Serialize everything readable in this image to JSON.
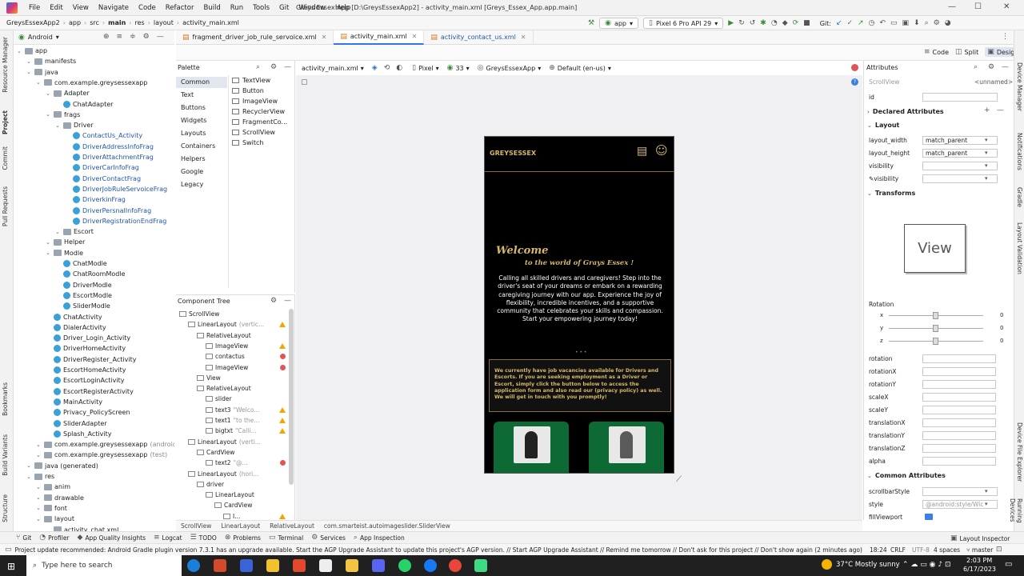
{
  "menubar": {
    "items": [
      "File",
      "Edit",
      "View",
      "Navigate",
      "Code",
      "Refactor",
      "Build",
      "Run",
      "Tools",
      "Git",
      "Window",
      "Help"
    ],
    "title": "Greys Essex App [D:\\GreysEssexApp2] - activity_main.xml [Greys_Essex_App.app.main]"
  },
  "navbar": {
    "crumbs": [
      "GreysEssexApp2",
      "app",
      "src",
      "main",
      "res",
      "layout",
      "activity_main.xml"
    ],
    "run_config": "app",
    "device": "Pixel 6 Pro API 29",
    "git_label": "Git:"
  },
  "project": {
    "view": "Android",
    "tree": [
      {
        "label": "app",
        "level": 0,
        "type": "folder"
      },
      {
        "label": "manifests",
        "level": 1,
        "type": "folder"
      },
      {
        "label": "java",
        "level": 1,
        "type": "folder"
      },
      {
        "label": "com.example.greysessexapp",
        "level": 2,
        "type": "folder"
      },
      {
        "label": "Adapter",
        "level": 3,
        "type": "folder"
      },
      {
        "label": "ChatAdapter",
        "level": 4,
        "type": "class"
      },
      {
        "label": "frags",
        "level": 3,
        "type": "folder"
      },
      {
        "label": "Driver",
        "level": 4,
        "type": "folder"
      },
      {
        "label": "ContactUs_Activity",
        "level": 5,
        "type": "class"
      },
      {
        "label": "DriverAddressInfoFrag",
        "level": 5,
        "type": "class"
      },
      {
        "label": "DriverAttachmentFrag",
        "level": 5,
        "type": "class"
      },
      {
        "label": "DriverCarInfoFrag",
        "level": 5,
        "type": "class"
      },
      {
        "label": "DriverContactFrag",
        "level": 5,
        "type": "class"
      },
      {
        "label": "DriverJobRuleServoiceFrag",
        "level": 5,
        "type": "class"
      },
      {
        "label": "DriverkinFrag",
        "level": 5,
        "type": "class"
      },
      {
        "label": "DriverPersnalInfoFrag",
        "level": 5,
        "type": "class"
      },
      {
        "label": "DriverRegistrationEndFrag",
        "level": 5,
        "type": "class"
      },
      {
        "label": "Escort",
        "level": 4,
        "type": "folder"
      },
      {
        "label": "Helper",
        "level": 3,
        "type": "folder"
      },
      {
        "label": "Modle",
        "level": 3,
        "type": "folder"
      },
      {
        "label": "ChatModle",
        "level": 4,
        "type": "class"
      },
      {
        "label": "ChatRoomModle",
        "level": 4,
        "type": "class"
      },
      {
        "label": "DriverModle",
        "level": 4,
        "type": "class"
      },
      {
        "label": "EscortModle",
        "level": 4,
        "type": "class"
      },
      {
        "label": "SliderModle",
        "level": 4,
        "type": "class"
      },
      {
        "label": "ChatActivity",
        "level": 3,
        "type": "class"
      },
      {
        "label": "DialerActivity",
        "level": 3,
        "type": "class"
      },
      {
        "label": "Driver_Login_Activity",
        "level": 3,
        "type": "class"
      },
      {
        "label": "DriverHomeActivity",
        "level": 3,
        "type": "class"
      },
      {
        "label": "DriverRegister_Activity",
        "level": 3,
        "type": "class"
      },
      {
        "label": "EscortHomeActivity",
        "level": 3,
        "type": "class"
      },
      {
        "label": "EscortLoginActivity",
        "level": 3,
        "type": "class"
      },
      {
        "label": "EscortRegisterActivity",
        "level": 3,
        "type": "class"
      },
      {
        "label": "MainActivity",
        "level": 3,
        "type": "class"
      },
      {
        "label": "Privacy_PolicyScreen",
        "level": 3,
        "type": "class"
      },
      {
        "label": "SliderAdapter",
        "level": 3,
        "type": "class"
      },
      {
        "label": "Splash_Activity",
        "level": 3,
        "type": "class"
      },
      {
        "label": "com.example.greysessexapp",
        "level": 2,
        "type": "folder",
        "suffix": "(androidTe"
      },
      {
        "label": "com.example.greysessexapp",
        "level": 2,
        "type": "folder",
        "suffix": "(test)"
      },
      {
        "label": "java (generated)",
        "level": 1,
        "type": "folder"
      },
      {
        "label": "res",
        "level": 1,
        "type": "folder"
      },
      {
        "label": "anim",
        "level": 2,
        "type": "folder"
      },
      {
        "label": "drawable",
        "level": 2,
        "type": "folder"
      },
      {
        "label": "font",
        "level": 2,
        "type": "folder"
      },
      {
        "label": "layout",
        "level": 2,
        "type": "folder"
      },
      {
        "label": "activity_chat.xml",
        "level": 3,
        "type": "file"
      }
    ]
  },
  "tabs": [
    {
      "label": "fragment_driver_job_rule_servoice.xml",
      "active": false
    },
    {
      "label": "activity_main.xml",
      "active": true
    },
    {
      "label": "activity_contact_us.xml",
      "active": false
    }
  ],
  "view_modes": [
    "Code",
    "Split",
    "Design"
  ],
  "palette": {
    "title": "Palette",
    "categories": [
      "Common",
      "Text",
      "Buttons",
      "Widgets",
      "Layouts",
      "Containers",
      "Helpers",
      "Google",
      "Legacy"
    ],
    "items": [
      "TextView",
      "Button",
      "ImageView",
      "RecyclerView",
      "FragmentCo...",
      "ScrollView",
      "Switch"
    ]
  },
  "design_toolbar": {
    "file": "activity_main.xml",
    "device": "Pixel",
    "api": "33",
    "theme": "GreysEssexApp",
    "locale": "Default (en-us)"
  },
  "component_tree": {
    "title": "Component Tree",
    "nodes": [
      {
        "label": "ScrollView",
        "level": 0,
        "mark": ""
      },
      {
        "label": "LinearLayout",
        "hint": "(vertic...",
        "level": 1,
        "mark": "warn"
      },
      {
        "label": "RelativeLayout",
        "level": 2,
        "mark": ""
      },
      {
        "label": "ImageView",
        "level": 3,
        "mark": "warn"
      },
      {
        "label": "contactus",
        "level": 3,
        "mark": "err"
      },
      {
        "label": "ImageView",
        "level": 3,
        "mark": "err"
      },
      {
        "label": "View",
        "level": 2,
        "mark": ""
      },
      {
        "label": "RelativeLayout",
        "level": 2,
        "mark": ""
      },
      {
        "label": "slider",
        "level": 3,
        "mark": ""
      },
      {
        "label": "text3",
        "hint": "\"Welco...",
        "level": 3,
        "mark": "warn"
      },
      {
        "label": "text1",
        "hint": "\"to the...",
        "level": 3,
        "mark": "warn"
      },
      {
        "label": "bigtxt",
        "hint": "\"Calli...",
        "level": 3,
        "mark": "warn"
      },
      {
        "label": "LinearLayout",
        "hint": "(verti...",
        "level": 1,
        "mark": ""
      },
      {
        "label": "CardView",
        "level": 2,
        "mark": ""
      },
      {
        "label": "text2",
        "hint": "\"@...",
        "level": 3,
        "mark": "err"
      },
      {
        "label": "LinearLayout",
        "hint": "(hori...",
        "level": 1,
        "mark": ""
      },
      {
        "label": "driver",
        "level": 2,
        "mark": ""
      },
      {
        "label": "LinearLayout",
        "level": 3,
        "mark": ""
      },
      {
        "label": "CardView",
        "level": 4,
        "mark": ""
      },
      {
        "label": "I...",
        "level": 5,
        "mark": "warn"
      }
    ]
  },
  "phone": {
    "logo": "GREYSESSEX",
    "welcome": "Welcome",
    "subtitle": "to the world of Grays Essex !",
    "body": "Calling all skilled drivers and caregivers! Step into the driver's seat of your dreams or embark on a rewarding caregiving journey with our app. Experience the joy of flexibility, incredible incentives, and a supportive community that celebrates your skills and compassion. Start your empowering journey today!",
    "notice": "We currently have job vacancies available for Drivers and Escorts. If you are seeking employment as a Driver or Escort, simply click the button below to access the application form and also read our (privacy policy) as well. We will get in touch with you promptly!",
    "dots": "• • •"
  },
  "attributes": {
    "title": "Attributes",
    "component": "ScrollView",
    "unnamed": "<unnamed>",
    "id_label": "id",
    "declared": "Declared Attributes",
    "layout": "Layout",
    "layout_width_label": "layout_width",
    "layout_width": "match_parent",
    "layout_height_label": "layout_height",
    "layout_height": "match_parent",
    "visibility_label": "visibility",
    "visibility2_label": "visibility",
    "transforms": "Transforms",
    "view_preview": "View",
    "rotation": "Rotation",
    "axes": [
      {
        "axis": "x",
        "value": "0"
      },
      {
        "axis": "y",
        "value": "0"
      },
      {
        "axis": "z",
        "value": "0"
      }
    ],
    "fields": [
      "rotation",
      "rotationX",
      "rotationY",
      "scaleX",
      "scaleY",
      "translationX",
      "translationY",
      "translationZ",
      "alpha"
    ],
    "common": "Common Attributes",
    "scrollbar_label": "scrollbarStyle",
    "style_label": "style",
    "style_value": "@android:style/Wic",
    "fill_label": "fillViewport"
  },
  "breadcrumb2": [
    "ScrollView",
    "LinearLayout",
    "RelativeLayout",
    "com.smarteist.autoimageslider.SliderView"
  ],
  "bottom_tools": [
    "Git",
    "Profiler",
    "App Quality Insights",
    "Logcat",
    "TODO",
    "Problems",
    "Terminal",
    "Services",
    "App Inspection"
  ],
  "layout_inspector": "Layout Inspector",
  "status_message": "Project update recommended: Android Gradle plugin version 7.3.1 has an upgrade available. Start the AGP Upgrade Assistant to update this project's AGP version. // Start AGP Upgrade Assistant // Remind me tomorrow // Don't ask for this project // Don't show again (2 minutes ago)",
  "status_right": {
    "pos": "18:24",
    "eol": "CRLF",
    "enc": "UTF-8",
    "indent": "4 spaces",
    "branch": "master"
  },
  "left_vtabs": [
    "Resource Manager",
    "Project",
    "Commit",
    "Pull Requests",
    "Bookmarks",
    "Build Variants",
    "Structure"
  ],
  "right_vtabs": [
    "Device Manager",
    "Notifications",
    "Gradle",
    "Layout Validation",
    "Device File Explorer",
    "Running Devices"
  ],
  "taskbar": {
    "search_placeholder": "Type here to search",
    "weather": "37°C  Mostly sunny",
    "time": "2:03 PM",
    "date": "6/17/2023"
  }
}
